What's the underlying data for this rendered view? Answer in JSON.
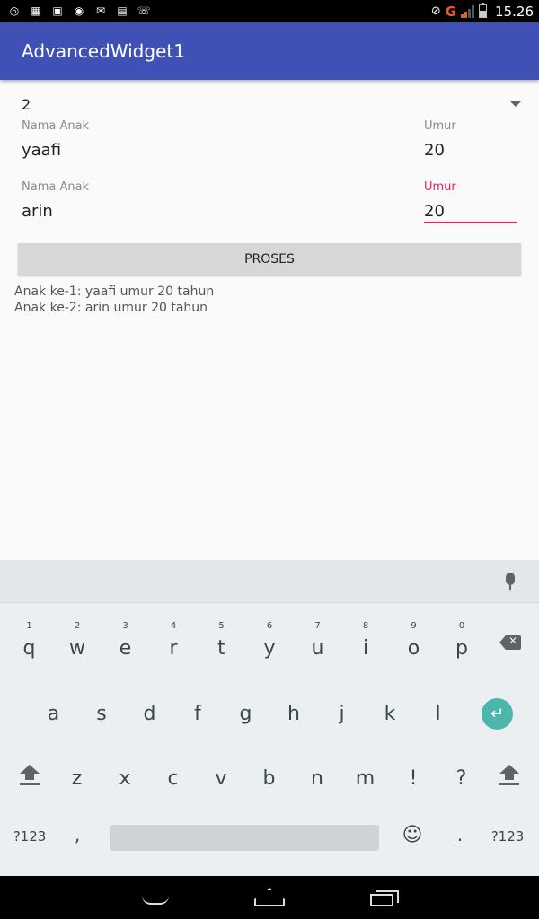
{
  "status_bar": {
    "time": "15.26",
    "network": "G",
    "battery_level": 0.55,
    "notification_icons": [
      "messenger-icon",
      "keyboard-icon",
      "image-icon",
      "whatsapp-icon",
      "gmail-icon",
      "chat-icon",
      "missed-call-icon"
    ]
  },
  "app_bar": {
    "title": "AdvancedWidget1"
  },
  "form": {
    "spinner_value": "2",
    "rows": [
      {
        "name_label": "Nama Anak",
        "name_value": "yaafi",
        "age_label": "Umur",
        "age_value": "20"
      },
      {
        "name_label": "Nama Anak",
        "name_value": "arin",
        "age_label": "Umur",
        "age_value": "20"
      }
    ],
    "process_button": "PROSES",
    "results": [
      "Anak ke-1: yaafi umur 20 tahun",
      "Anak ke-2: arin umur 20 tahun"
    ],
    "accent_color": "#e91e63",
    "primary_color": "#3f51b5"
  },
  "keyboard": {
    "row1": [
      {
        "k": "q",
        "h": "1"
      },
      {
        "k": "w",
        "h": "2"
      },
      {
        "k": "e",
        "h": "3"
      },
      {
        "k": "r",
        "h": "4"
      },
      {
        "k": "t",
        "h": "5"
      },
      {
        "k": "y",
        "h": "6"
      },
      {
        "k": "u",
        "h": "7"
      },
      {
        "k": "i",
        "h": "8"
      },
      {
        "k": "o",
        "h": "9"
      },
      {
        "k": "p",
        "h": "0"
      }
    ],
    "row2": [
      "a",
      "s",
      "d",
      "f",
      "g",
      "h",
      "j",
      "k",
      "l"
    ],
    "row3": [
      "z",
      "x",
      "c",
      "v",
      "b",
      "n",
      "m",
      "!",
      "?"
    ],
    "symbols_label": "?123",
    "comma": ",",
    "period": ".",
    "emoji": "☺",
    "enter_glyph": "↵"
  }
}
